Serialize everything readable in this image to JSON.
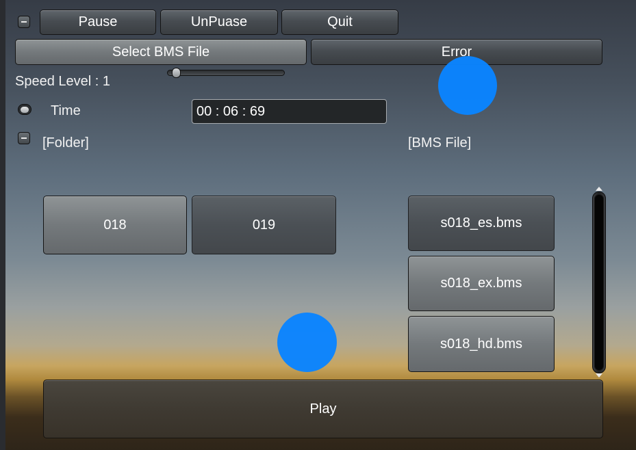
{
  "toolbar": {
    "pause_label": "Pause",
    "unpause_label": "UnPuase",
    "quit_label": "Quit"
  },
  "file_row": {
    "select_label": "Select BMS File",
    "error_label": "Error"
  },
  "speed": {
    "label": "Speed Level : 1",
    "level_fraction": 0.0
  },
  "time": {
    "label": "Time",
    "value": "00 : 06 : 69"
  },
  "folders": {
    "header": "[Folder]",
    "items": [
      "018",
      "019"
    ]
  },
  "bms_files": {
    "header": "[BMS File]",
    "items": [
      "s018_es.bms",
      "s018_ex.bms",
      "s018_hd.bms"
    ]
  },
  "play_label": "Play",
  "colors": {
    "touch_indicator": "#0a84ff"
  }
}
